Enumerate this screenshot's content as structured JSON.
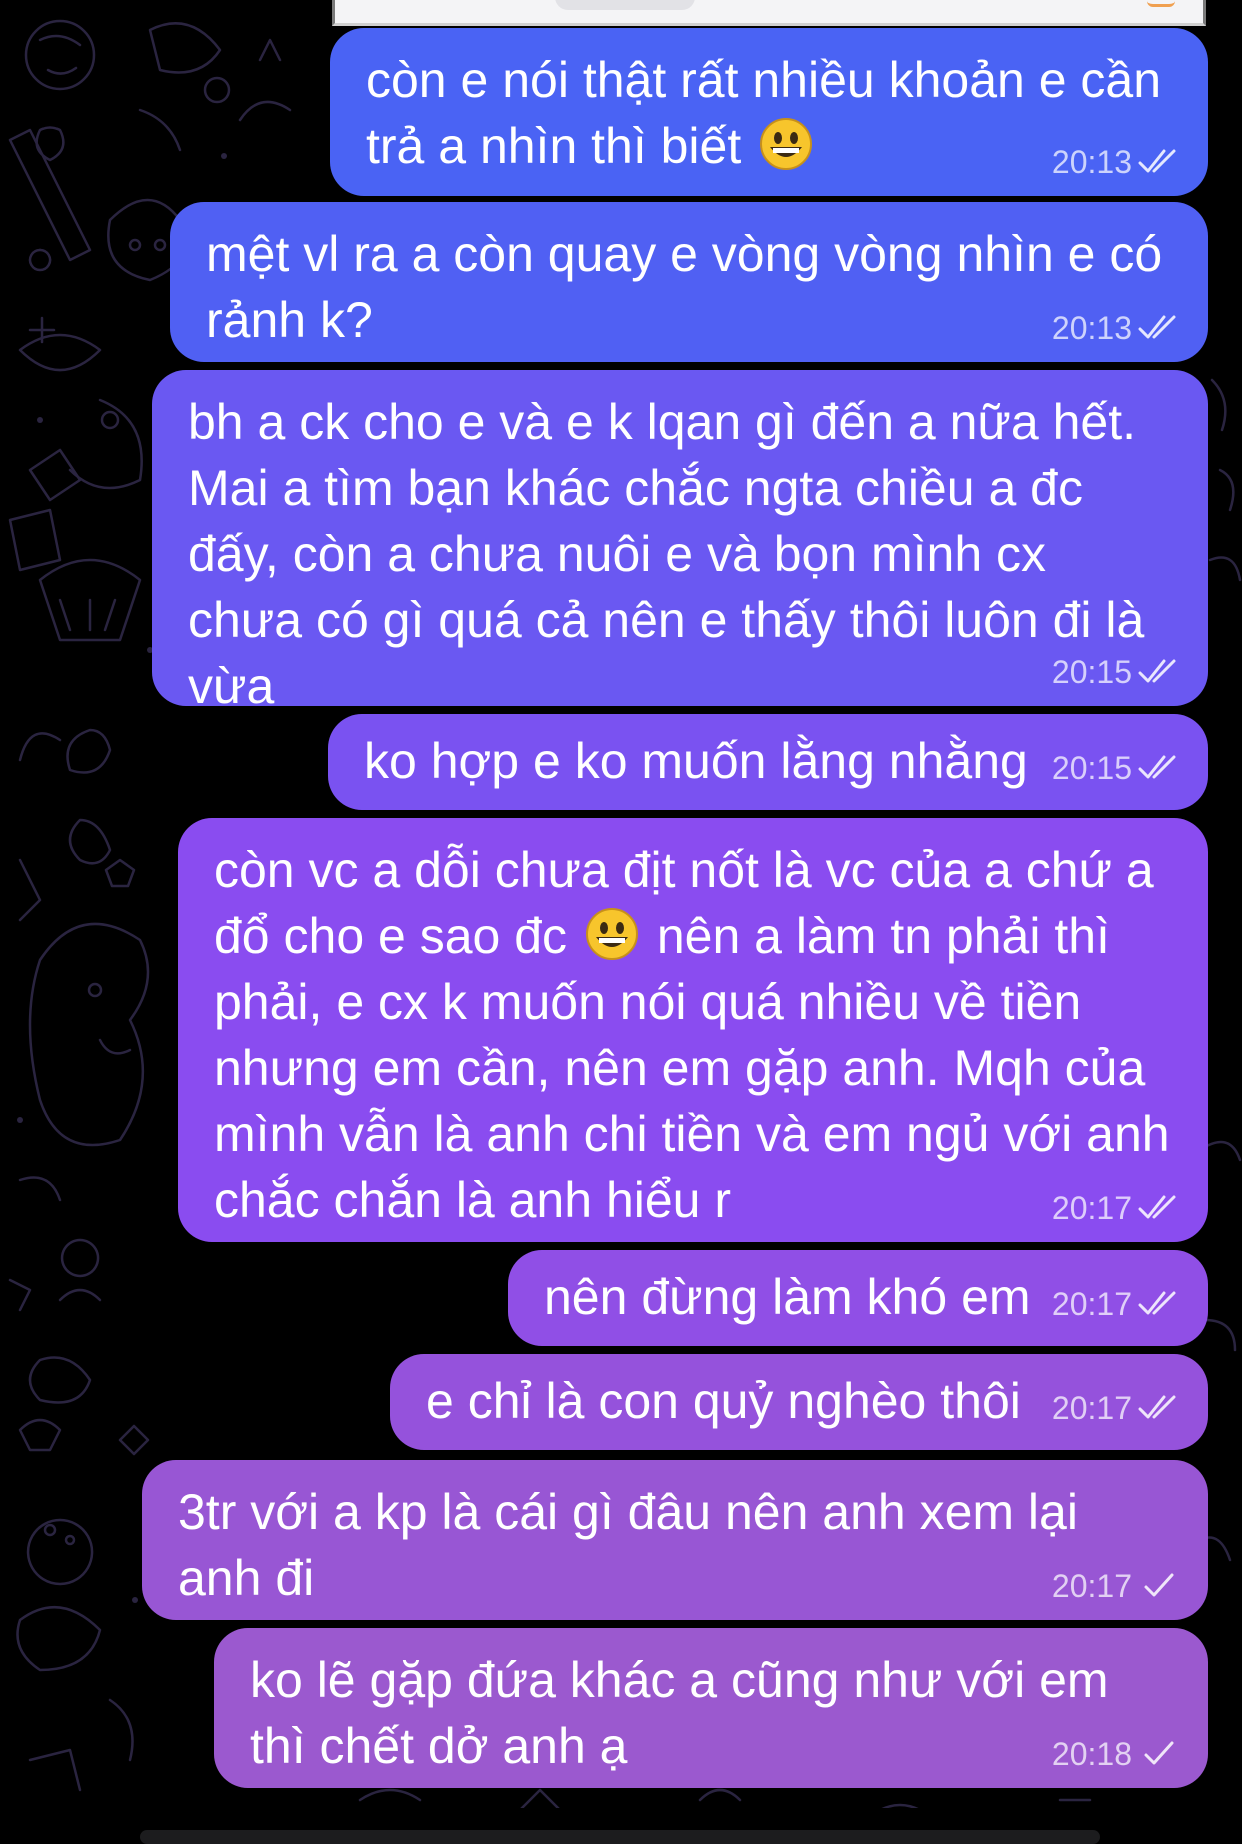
{
  "theme": {
    "background": "#000000",
    "bubble_gradient_top": "#4a63f4",
    "bubble_gradient_mid": "#8a4cf0",
    "bubble_gradient_bottom": "#9b59cf",
    "meta_color": "rgba(255,255,255,0.72)"
  },
  "messages": [
    {
      "text": "còn e nói thật rất nhiều khoản e cần trả a nhìn thì biết",
      "emoji": "grinning-face-emoji",
      "time": "20:13",
      "status": "read",
      "status_icon": "double-check-icon"
    },
    {
      "text": "mệt vl ra a còn quay e vòng vòng nhìn e có rảnh k?",
      "time": "20:13",
      "status": "read",
      "status_icon": "double-check-icon"
    },
    {
      "text": "bh a ck cho e và e k lqan gì đến a nữa hết. Mai a tìm bạn khác chắc ngta chiều a đc đấy, còn a chưa nuôi e và bọn mình cx chưa có gì quá cả nên e thấy thôi luôn đi là vừa",
      "time": "20:15",
      "status": "read",
      "status_icon": "double-check-icon"
    },
    {
      "text": "ko hợp e ko muốn lằng nhằng",
      "time": "20:15",
      "status": "read",
      "status_icon": "double-check-icon"
    },
    {
      "text_before_emoji": "còn vc a dỗi  chưa địt nốt là vc của a chứ a đổ cho e sao đc",
      "emoji": "grinning-face-emoji",
      "text_after_emoji": "nên a làm tn phải thì phải, e cx k muốn nói quá nhiều về tiền nhưng em cần, nên em gặp anh. Mqh của mình vẫn là anh chi tiền và em ngủ với anh chắc chắn là anh hiểu r",
      "time": "20:17",
      "status": "read",
      "status_icon": "double-check-icon"
    },
    {
      "text": "nên đừng làm khó em",
      "time": "20:17",
      "status": "read",
      "status_icon": "double-check-icon"
    },
    {
      "text": "e chỉ là con quỷ nghèo thôi",
      "time": "20:17",
      "status": "read",
      "status_icon": "double-check-icon"
    },
    {
      "text": "3tr với a kp là cái gì đâu nên anh xem lại anh đi",
      "time": "20:17",
      "status": "sent",
      "status_icon": "single-check-icon"
    },
    {
      "text": "ko lẽ gặp đứa khác a cũng như với em thì chết dở anh ạ",
      "time": "20:18",
      "status": "sent",
      "status_icon": "single-check-icon"
    }
  ]
}
